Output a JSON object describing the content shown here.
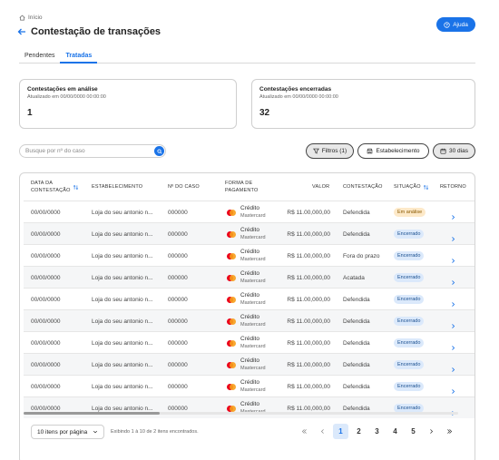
{
  "breadcrumb": {
    "home": "Início"
  },
  "header": {
    "title": "Contestação de transações",
    "help_label": "Ajuda"
  },
  "tabs": [
    {
      "label": "Pendentes",
      "active": false
    },
    {
      "label": "Tratadas",
      "active": true
    }
  ],
  "cards": [
    {
      "title": "Contestações em análise",
      "subtitle": "Atualizado em 00/00/0000 00:00:00",
      "value": "1"
    },
    {
      "title": "Contestações encerradas",
      "subtitle": "Atualizado em 00/00/0000 00:00:00",
      "value": "32"
    }
  ],
  "search": {
    "placeholder": "Busque por nº do caso"
  },
  "filters": {
    "filters_label": "Filtros (1)",
    "establishment_label": "Estabelecimento",
    "period_label": "30 dias"
  },
  "table": {
    "headers": {
      "date_l1": "DATA DA",
      "date_l2": "CONTESTAÇÃO",
      "establishment": "ESTABELECIMENTO",
      "case": "Nº DO CASO",
      "payment_l1": "FORMA DE",
      "payment_l2": "PAGAMENTO",
      "value": "VALOR",
      "contestation": "CONTESTAÇÃO",
      "status": "SITUAÇÃO",
      "return": "RETORNO"
    },
    "rows": [
      {
        "date": "00/00/0000",
        "establishment": "Loja do seu antonio n...",
        "case": "000000",
        "pay_type": "Crédito",
        "pay_brand": "Mastercard",
        "value": "R$ 11.00,000,00",
        "contestation": "Defendida",
        "status": "Em análise"
      },
      {
        "date": "00/00/0000",
        "establishment": "Loja do seu antonio n...",
        "case": "000000",
        "pay_type": "Crédito",
        "pay_brand": "Mastercard",
        "value": "R$ 11.00,000,00",
        "contestation": "Defendida",
        "status": "Encerrado"
      },
      {
        "date": "00/00/0000",
        "establishment": "Loja do seu antonio n...",
        "case": "000000",
        "pay_type": "Crédito",
        "pay_brand": "Mastercard",
        "value": "R$ 11.00,000,00",
        "contestation": "Fora do prazo",
        "status": "Encerrado"
      },
      {
        "date": "00/00/0000",
        "establishment": "Loja do seu antonio n...",
        "case": "000000",
        "pay_type": "Crédito",
        "pay_brand": "Mastercard",
        "value": "R$ 11.00,000,00",
        "contestation": "Acatada",
        "status": "Encerrado"
      },
      {
        "date": "00/00/0000",
        "establishment": "Loja do seu antonio n...",
        "case": "000000",
        "pay_type": "Crédito",
        "pay_brand": "Mastercard",
        "value": "R$ 11.00,000,00",
        "contestation": "Defendida",
        "status": "Encerrado"
      },
      {
        "date": "00/00/0000",
        "establishment": "Loja do seu antonio n...",
        "case": "000000",
        "pay_type": "Crédito",
        "pay_brand": "Mastercard",
        "value": "R$ 11.00,000,00",
        "contestation": "Defendida",
        "status": "Encerrado"
      },
      {
        "date": "00/00/0000",
        "establishment": "Loja do seu antonio n...",
        "case": "000000",
        "pay_type": "Crédito",
        "pay_brand": "Mastercard",
        "value": "R$ 11.00,000,00",
        "contestation": "Defendida",
        "status": "Encerrado"
      },
      {
        "date": "00/00/0000",
        "establishment": "Loja do seu antonio n...",
        "case": "000000",
        "pay_type": "Crédito",
        "pay_brand": "Mastercard",
        "value": "R$ 11.00,000,00",
        "contestation": "Defendida",
        "status": "Encerrado"
      },
      {
        "date": "00/00/0000",
        "establishment": "Loja do seu antonio n...",
        "case": "000000",
        "pay_type": "Crédito",
        "pay_brand": "Mastercard",
        "value": "R$ 11.00,000,00",
        "contestation": "Defendida",
        "status": "Encerrado"
      },
      {
        "date": "00/00/0000",
        "establishment": "Loja do seu antonio n...",
        "case": "000000",
        "pay_type": "Crédito",
        "pay_brand": "Mastercard",
        "value": "R$ 11.00,000,00",
        "contestation": "Defendida",
        "status": "Encerrado"
      }
    ]
  },
  "pagination": {
    "per_page": "10 itens por página",
    "showing": "Exibindo 1 à 10 de 2 itens encontrados.",
    "pages": [
      "1",
      "2",
      "3",
      "4",
      "5"
    ],
    "current": "1"
  },
  "colors": {
    "accent": "#1a73e8",
    "analysis_badge": "#fde9c9",
    "closed_badge": "#dbe9fb"
  }
}
